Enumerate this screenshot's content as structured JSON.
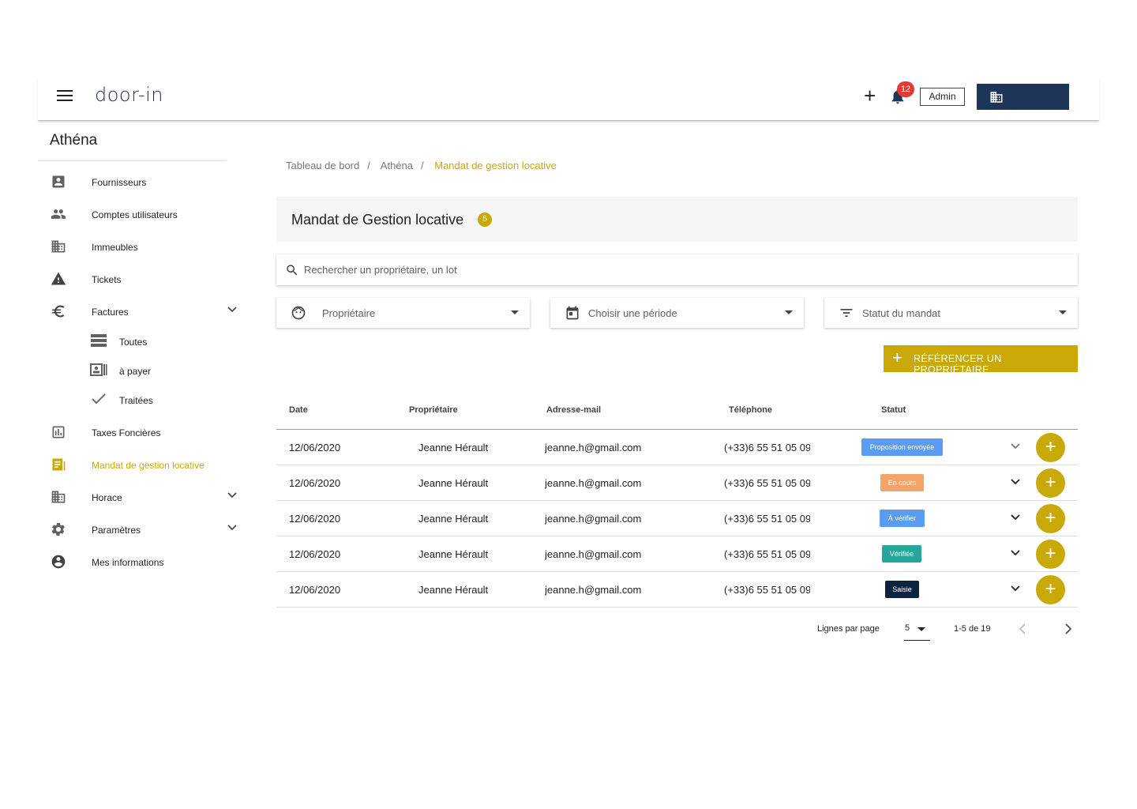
{
  "app": {
    "logo": "door-in",
    "notifications_count": "12",
    "admin_label": "Admin"
  },
  "sidebar": {
    "org_name": "Athéna",
    "items": [
      {
        "label": "Fournisseurs",
        "icon": "contact-card-icon"
      },
      {
        "label": "Comptes utilisateurs",
        "icon": "people-icon"
      },
      {
        "label": "Immeubles",
        "icon": "building-icon"
      },
      {
        "label": "Tickets",
        "icon": "warning-icon"
      },
      {
        "label": "Factures",
        "icon": "euro-icon"
      },
      {
        "label": "Taxes Foncières",
        "icon": "bar-chart-icon"
      },
      {
        "label": "Mandat de gestion locative",
        "icon": "document-icon"
      },
      {
        "label": "Horace",
        "icon": "building-icon"
      },
      {
        "label": "Paramètres",
        "icon": "gear-icon"
      },
      {
        "label": "Mes informations",
        "icon": "account-icon"
      }
    ],
    "factures_sub": [
      {
        "label": "Toutes",
        "icon": "list-icon"
      },
      {
        "label": "à payer",
        "icon": "payment-icon"
      },
      {
        "label": "Traitées",
        "icon": "check-icon"
      }
    ],
    "active_label": "Mandat de gestion locative"
  },
  "breadcrumb": [
    "Tableau de bord",
    "Athéna",
    "Mandat de gestion locative"
  ],
  "breadcrumb_separator": "/",
  "header": {
    "title": "Mandat de Gestion locative",
    "count": "5"
  },
  "search": {
    "placeholder": "Rechercher un propriétaire, un lot"
  },
  "filters": [
    {
      "label": "Propriétaire",
      "icon": "face-icon"
    },
    {
      "label": "Choisir une période",
      "icon": "calendar-icon"
    },
    {
      "label": "Statut du mandat",
      "icon": "filter-icon"
    }
  ],
  "add_owner_button": "RÉFÉRENCER UN PROPRIÉTAIRE",
  "table": {
    "columns": [
      "Date",
      "Propriétaire",
      "Adresse-mail",
      "Téléphone",
      "Statut"
    ],
    "rows": [
      {
        "date": "12/06/2020",
        "owner": "Jeanne Hérault",
        "email": "jeanne.h@gmail.com",
        "phone": "(+33)6 55 51 05 09",
        "status": "Proposition envoyée",
        "status_color": "#5b9cf2"
      },
      {
        "date": "12/06/2020",
        "owner": "Jeanne Hérault",
        "email": "jeanne.h@gmail.com",
        "phone": "(+33)6 55 51 05 09",
        "status": "En cours",
        "status_color": "#f4a46a"
      },
      {
        "date": "12/06/2020",
        "owner": "Jeanne Hérault",
        "email": "jeanne.h@gmail.com",
        "phone": "(+33)6 55 51 05 09",
        "status": "À vérifier",
        "status_color": "#5b9cf2"
      },
      {
        "date": "12/06/2020",
        "owner": "Jeanne Hérault",
        "email": "jeanne.h@gmail.com",
        "phone": "(+33)6 55 51 05 09",
        "status": "Vérifiée",
        "status_color": "#26a69a"
      },
      {
        "date": "12/06/2020",
        "owner": "Jeanne Hérault",
        "email": "jeanne.h@gmail.com",
        "phone": "(+33)6 55 51 05 09",
        "status": "Saisie",
        "status_color": "#0b2440"
      }
    ]
  },
  "pagination": {
    "rows_per_page_label": "Lignes par page",
    "rows_per_page": "5",
    "range": "1-5 de 19"
  },
  "colors": {
    "accent": "#c9a907",
    "navy": "#1d3557"
  }
}
